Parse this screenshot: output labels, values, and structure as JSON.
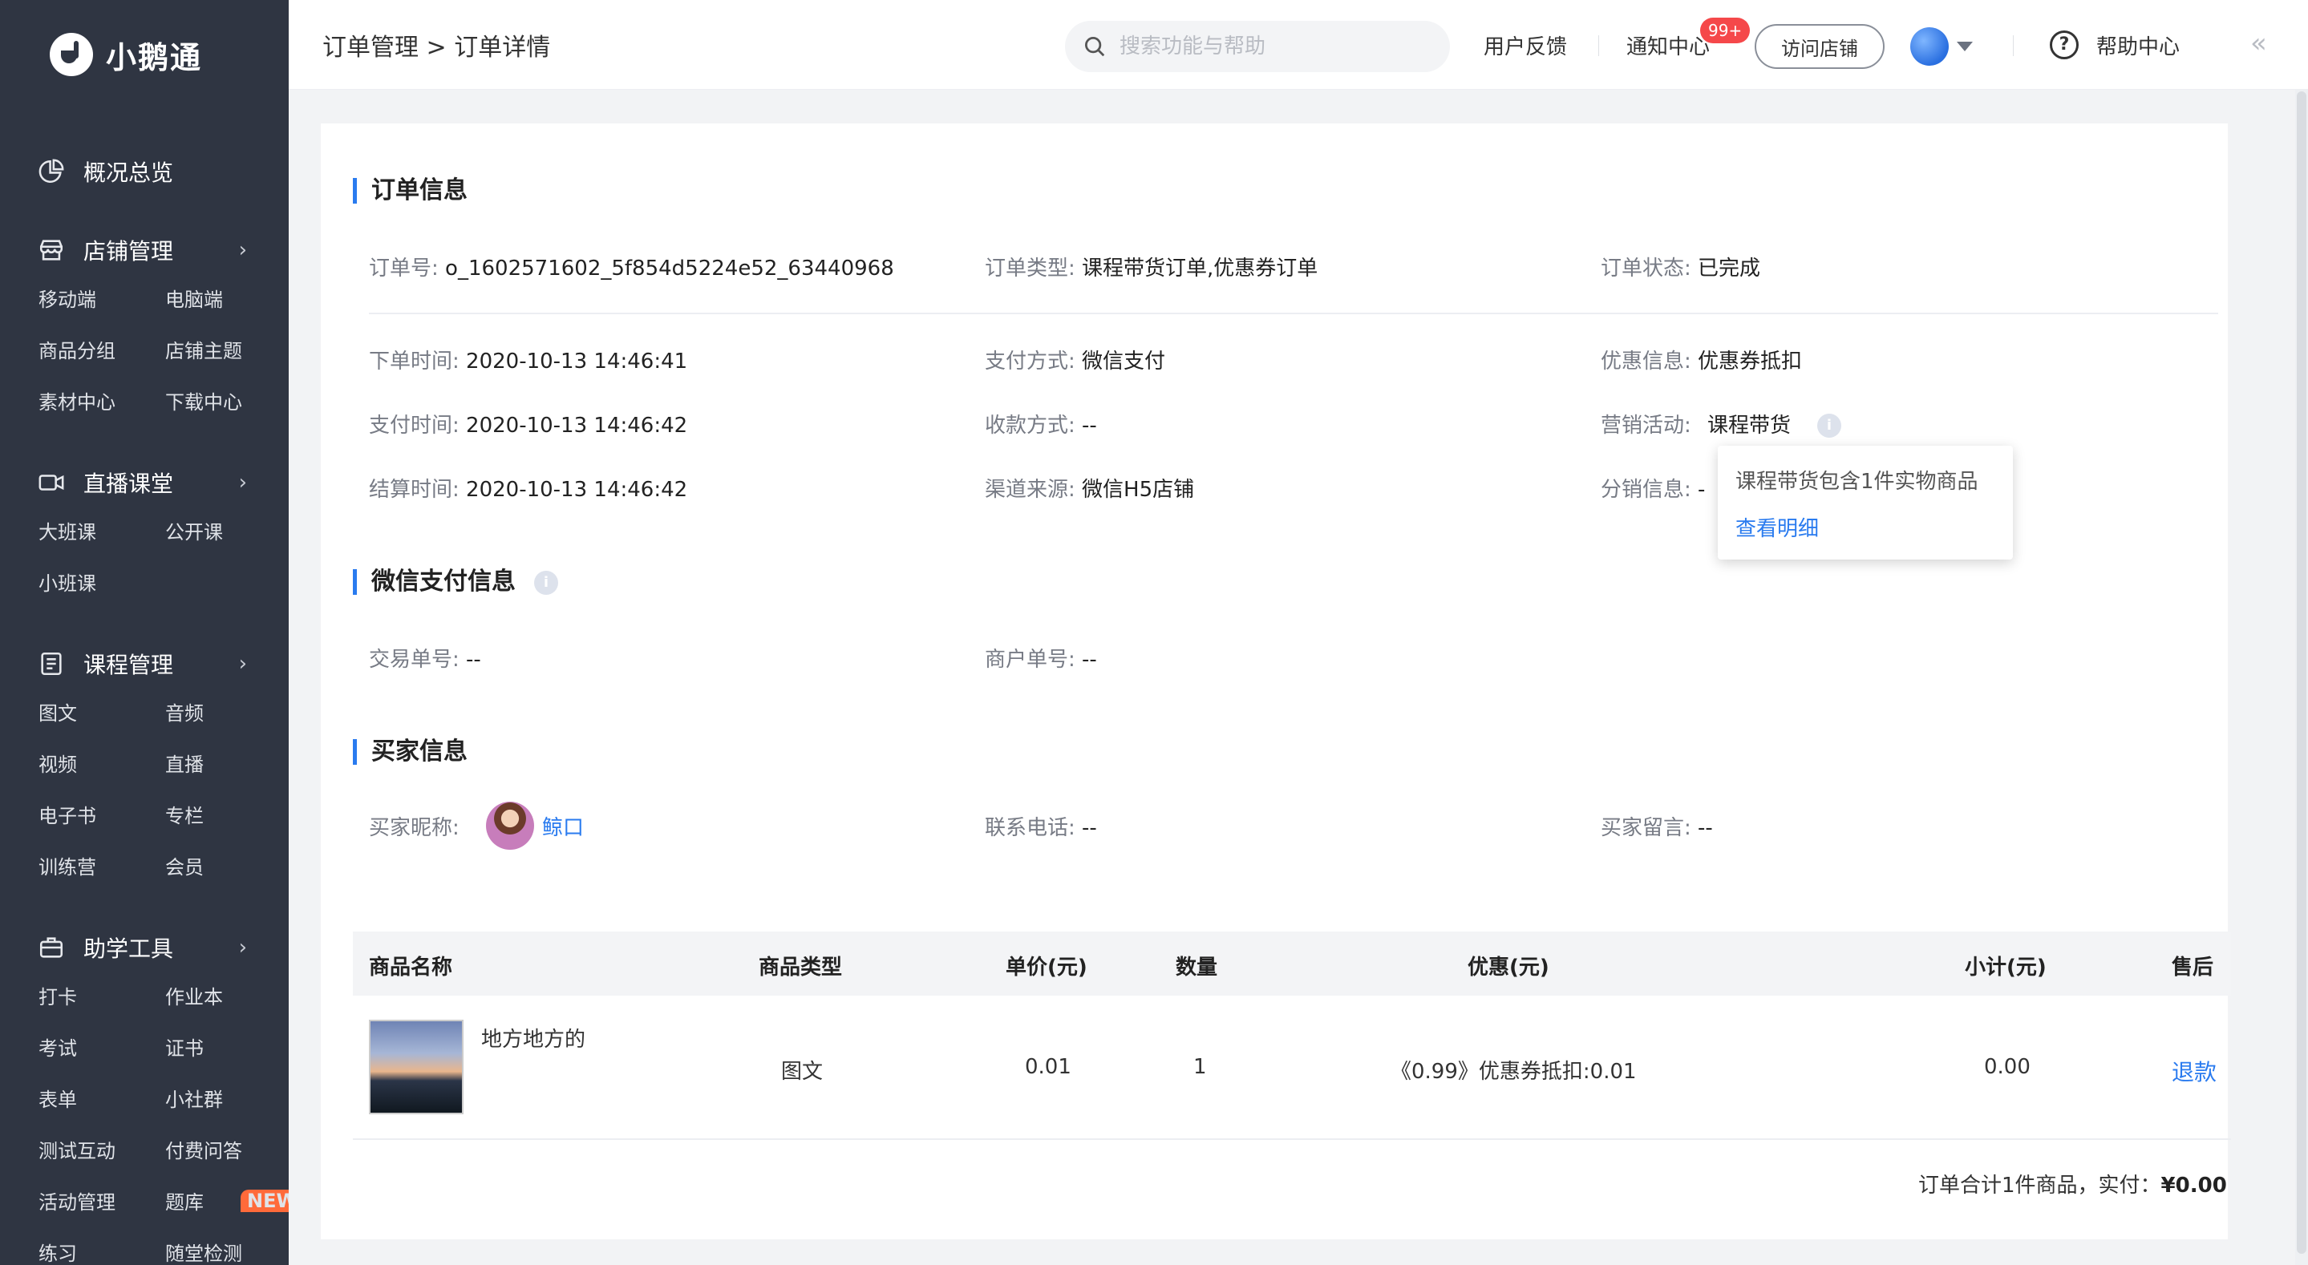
{
  "sidebar": {
    "logo_text": "小鹅通",
    "overview": "概况总览",
    "groups": [
      {
        "label": "店铺管理",
        "items": [
          "移动端",
          "电脑端",
          "商品分组",
          "店铺主题",
          "素材中心",
          "下载中心"
        ]
      },
      {
        "label": "直播课堂",
        "items": [
          "大班课",
          "公开课",
          "小班课"
        ]
      },
      {
        "label": "课程管理",
        "items": [
          "图文",
          "音频",
          "视频",
          "直播",
          "电子书",
          "专栏",
          "训练营",
          "会员"
        ]
      },
      {
        "label": "助学工具",
        "items": [
          "打卡",
          "作业本",
          "考试",
          "证书",
          "表单",
          "小社群",
          "测试互动",
          "付费问答",
          "活动管理",
          "题库",
          "练习",
          "随堂检测"
        ]
      }
    ],
    "new_badge": "NEW",
    "chevron": "›"
  },
  "topbar": {
    "breadcrumb": "订单管理 > 订单详情",
    "search_placeholder": "搜索功能与帮助",
    "feedback": "用户反馈",
    "notifications": "通知中心",
    "notif_badge": "99+",
    "visit_store": "访问店铺",
    "help": "帮助中心",
    "collapse": "«"
  },
  "order_info": {
    "title": "订单信息",
    "order_no_label": "订单号:",
    "order_no": "o_1602571602_5f854d5224e52_63440968",
    "order_type_label": "订单类型:",
    "order_type": "课程带货订单,优惠券订单",
    "order_status_label": "订单状态:",
    "order_status": "已完成",
    "order_time_label": "下单时间:",
    "order_time": "2020-10-13 14:46:41",
    "pay_method_label": "支付方式:",
    "pay_method": "微信支付",
    "discount_label": "优惠信息:",
    "discount": "优惠券抵扣",
    "pay_time_label": "支付时间:",
    "pay_time": "2020-10-13 14:46:42",
    "collect_label": "收款方式:",
    "collect": "--",
    "marketing_label": "营销活动:",
    "marketing": "课程带货",
    "settle_time_label": "结算时间:",
    "settle_time": "2020-10-13 14:46:42",
    "channel_label": "渠道来源:",
    "channel": "微信H5店铺",
    "distribution_label": "分销信息:",
    "distribution": "-"
  },
  "tooltip": {
    "text": "课程带货包含1件实物商品",
    "link": "查看明细"
  },
  "wechat_pay": {
    "title": "微信支付信息",
    "trade_no_label": "交易单号:",
    "trade_no": "--",
    "merchant_no_label": "商户单号:",
    "merchant_no": "--"
  },
  "buyer": {
    "title": "买家信息",
    "nickname_label": "买家昵称:",
    "nickname": "鲸口",
    "phone_label": "联系电话:",
    "phone": "--",
    "message_label": "买家留言:",
    "message": "--"
  },
  "table": {
    "headers": [
      "商品名称",
      "商品类型",
      "单价(元)",
      "数量",
      "优惠(元)",
      "小计(元)",
      "售后"
    ],
    "rows": [
      {
        "name": "地方地方的",
        "type": "图文",
        "price": "0.01",
        "qty": "1",
        "discount": "《0.99》优惠券抵扣:0.01",
        "subtotal": "0.00",
        "action": "退款"
      }
    ],
    "summary_prefix": "订单合计1件商品，实付：",
    "summary_amount": "¥0.00"
  },
  "icons": {
    "overview": "pie-chart-icon",
    "store": "store-icon",
    "live": "video-camera-icon",
    "course": "document-list-icon",
    "tools": "briefcase-icon",
    "search": "search-icon",
    "help": "question-circle-icon",
    "info": "info-icon"
  },
  "colors": {
    "sidebar_bg": "#2f3542",
    "accent": "#2a7bef",
    "badge_red": "#f5484a",
    "new_badge": "#ff6a3a"
  }
}
